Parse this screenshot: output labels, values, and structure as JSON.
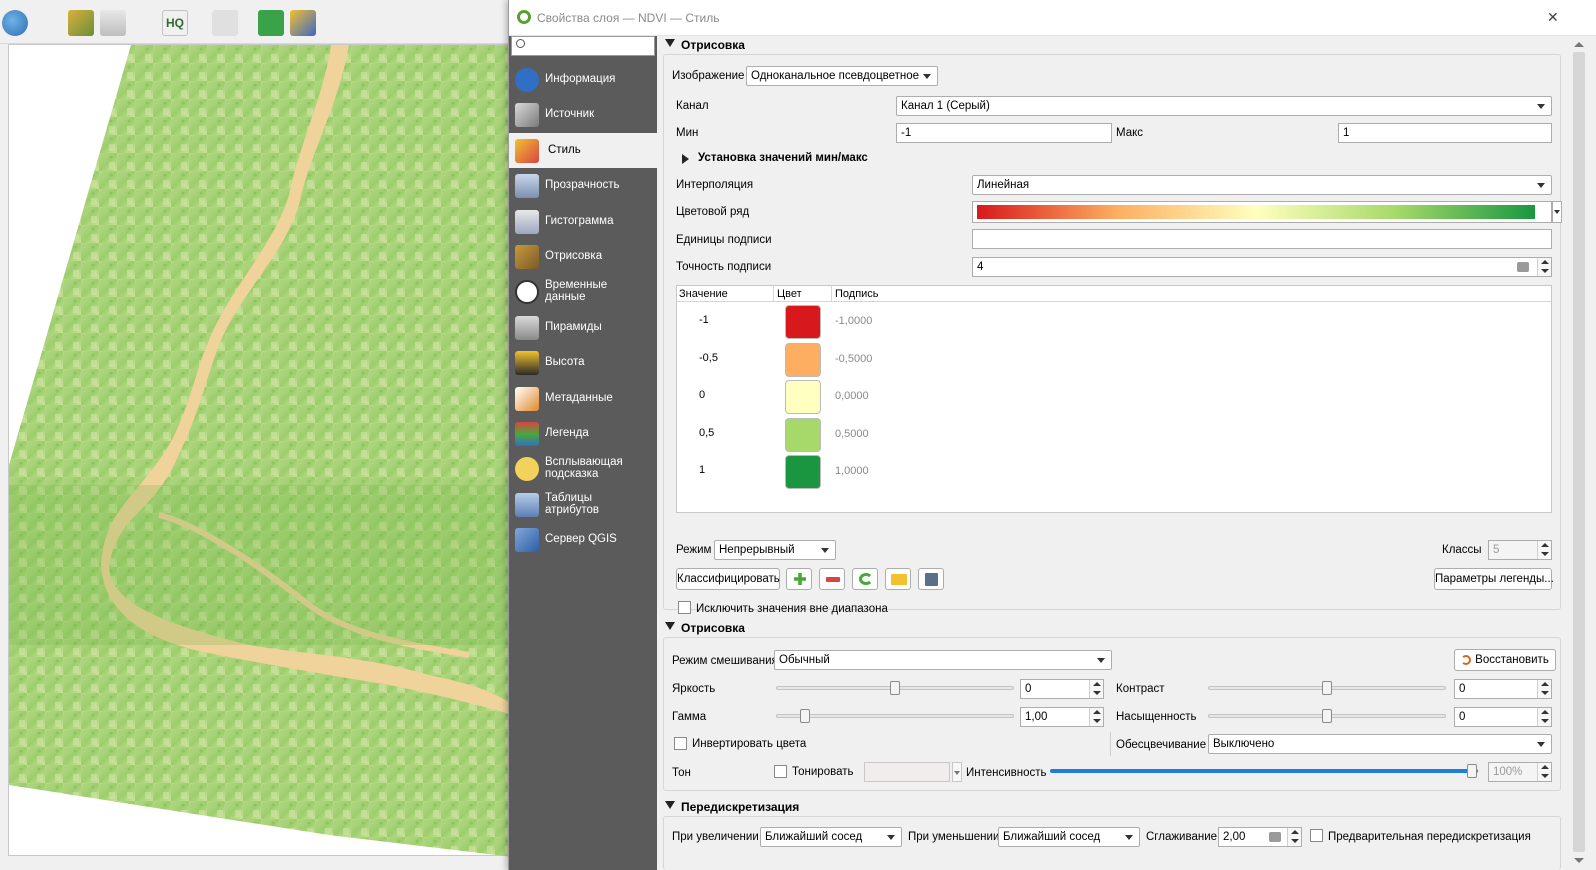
{
  "map": {},
  "dialog": {
    "title": "Свойства слоя — NDVI — Стиль",
    "close_glyph": "✕",
    "search_placeholder": ""
  },
  "sidebar": {
    "items": [
      {
        "label": "Информация",
        "icon": "info-icon"
      },
      {
        "label": "Источник",
        "icon": "source-icon"
      },
      {
        "label": "Стиль",
        "icon": "style-brush-icon"
      },
      {
        "label": "Прозрачность",
        "icon": "transparency-icon"
      },
      {
        "label": "Гистограмма",
        "icon": "histogram-icon"
      },
      {
        "label": "Отрисовка",
        "icon": "rendering-brush-icon"
      },
      {
        "label": "Временные данные",
        "icon": "clock-icon"
      },
      {
        "label": "Пирамиды",
        "icon": "pyramids-icon"
      },
      {
        "label": "Высота",
        "icon": "elevation-icon"
      },
      {
        "label": "Метаданные",
        "icon": "metadata-icon"
      },
      {
        "label": "Легенда",
        "icon": "legend-icon"
      },
      {
        "label": "Всплывающая подсказка",
        "icon": "tooltip-icon"
      },
      {
        "label": "Таблицы атрибутов",
        "icon": "attribute-table-icon"
      },
      {
        "label": "Сервер QGIS",
        "icon": "server-icon"
      }
    ],
    "active": "Стиль"
  },
  "band_rendering": {
    "section_title": "Отрисовка",
    "render_type_label": "Изображение",
    "render_type_value": "Одноканальное псевдоцветное",
    "band_label": "Канал",
    "band_value": "Канал 1 (Серый)",
    "min_label": "Мин",
    "min_value": "-1",
    "max_label": "Макс",
    "max_value": "1",
    "minmax_subsection": "Установка значений мин/макс",
    "interpolation_label": "Интерполяция",
    "interpolation_value": "Линейная",
    "color_ramp_label": "Цветовой ряд",
    "label_unit_label": "Единицы подписи",
    "label_unit_value": "",
    "label_precision_label": "Точность подписи",
    "label_precision_value": "4",
    "table_headers": [
      "Значение",
      "Цвет",
      "Подпись"
    ],
    "classes": [
      {
        "value": "-1",
        "color": "#d7191c",
        "label": "-1,0000"
      },
      {
        "value": "-0,5",
        "color": "#fdae61",
        "label": "-0,5000"
      },
      {
        "value": "0",
        "color": "#ffffbf",
        "label": "0,0000"
      },
      {
        "value": "0,5",
        "color": "#a6d96a",
        "label": "0,5000"
      },
      {
        "value": "1",
        "color": "#1a9641",
        "label": "1,0000"
      }
    ],
    "mode_label": "Режим",
    "mode_value": "Непрерывный",
    "classes_label": "Классы",
    "classes_value": "5",
    "classify_button": "Классифицировать",
    "legend_settings_button": "Параметры легенды...",
    "clip_out_of_range_label": "Исключить значения вне диапазона"
  },
  "color_rendering": {
    "section_title": "Отрисовка",
    "blend_mode_label": "Режим смешивания",
    "blend_mode_value": "Обычный",
    "reset_button": "Восстановить",
    "brightness_label": "Яркость",
    "brightness_value": "0",
    "contrast_label": "Контраст",
    "contrast_value": "0",
    "gamma_label": "Гамма",
    "gamma_value": "1,00",
    "saturation_label": "Насыщенность",
    "saturation_value": "0",
    "invert_label": "Инвертировать цвета",
    "grayscale_label": "Обесцвечивание",
    "grayscale_value": "Выключено",
    "hue_label": "Тон",
    "colorize_label": "Тонировать",
    "strength_label": "Интенсивность",
    "strength_value": "100%",
    "brightness_level": 0.5,
    "contrast_level": 0.5,
    "gamma_level": 0.1,
    "saturation_level": 0.5,
    "strength_level": 1.0
  },
  "resampling": {
    "section_title": "Передискретизация",
    "zoomed_in_label": "При увеличении",
    "zoomed_in_value": "Ближайший сосед",
    "zoomed_out_label": "При уменьшении",
    "zoomed_out_value": "Ближайший сосед",
    "oversampling_label": "Сглаживание",
    "oversampling_value": "2,00",
    "early_resampling_label": "Предварительная передискретизация"
  },
  "colors": {
    "sidebar_bg": "#5b5b5b",
    "ramp": [
      "#d7191c",
      "#fdae61",
      "#ffffbf",
      "#a6d96a",
      "#1a9641"
    ],
    "slider_accent": "#1e7fd6"
  }
}
